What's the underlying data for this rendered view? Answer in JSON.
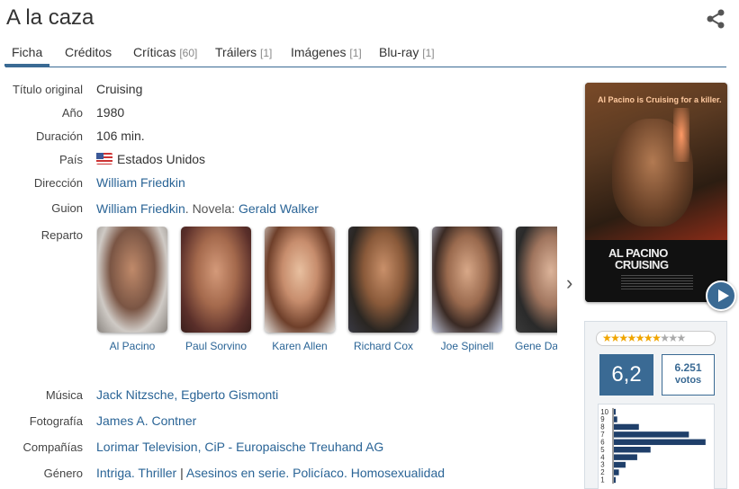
{
  "title": "A la caza",
  "tabs": [
    {
      "label": "Ficha",
      "count": ""
    },
    {
      "label": "Créditos",
      "count": ""
    },
    {
      "label": "Críticas",
      "count": "[60]"
    },
    {
      "label": "Tráilers",
      "count": "[1]"
    },
    {
      "label": "Imágenes",
      "count": "[1]"
    },
    {
      "label": "Blu-ray",
      "count": "[1]"
    }
  ],
  "info": {
    "original_title_label": "Título original",
    "original_title": "Cruising",
    "year_label": "Año",
    "year": "1980",
    "duration_label": "Duración",
    "duration": "106 min.",
    "country_label": "País",
    "country": "Estados Unidos",
    "direction_label": "Dirección",
    "director": "William Friedkin",
    "script_label": "Guion",
    "script_writer": "William Friedkin",
    "script_sep": ". Novela: ",
    "novel_author": "Gerald Walker",
    "cast_label": "Reparto",
    "music_label": "Música",
    "music": "Jack Nitzsche, Egberto Gismonti",
    "photo_label": "Fotografía",
    "photo": "James A. Contner",
    "companies_label": "Compañías",
    "companies": "Lorimar Television, CiP - Europaische Treuhand AG",
    "genre_label": "Género",
    "genre_1": "Intriga. Thriller",
    "genre_sep": " | ",
    "genre_2": "Asesinos en serie. Policíaco. Homosexualidad"
  },
  "cast": [
    {
      "name": "Al Pacino"
    },
    {
      "name": "Paul Sorvino"
    },
    {
      "name": "Karen Allen"
    },
    {
      "name": "Richard Cox"
    },
    {
      "name": "Joe Spinell"
    },
    {
      "name": "Gene Davis"
    }
  ],
  "poster": {
    "tagline": "Al Pacino is Cruising for a killer.",
    "line1": "AL PACINO",
    "line2": "CRUISING"
  },
  "rating": {
    "stars_filled": 7,
    "stars_total": 10,
    "average": "6,2",
    "votes_count": "6.251",
    "votes_label": "votos",
    "histogram_labels": [
      "10",
      "9",
      "8",
      "7",
      "6",
      "5",
      "4",
      "3",
      "2",
      "1"
    ],
    "histogram_values": [
      1,
      2,
      15,
      45,
      55,
      22,
      14,
      7,
      3,
      1
    ]
  },
  "colors": {
    "accent": "#3a6a94",
    "link": "#2a6496",
    "star": "#f0a500"
  },
  "icons": {
    "share": "share-icon",
    "next": "chevron-right-icon",
    "play": "play-icon"
  }
}
